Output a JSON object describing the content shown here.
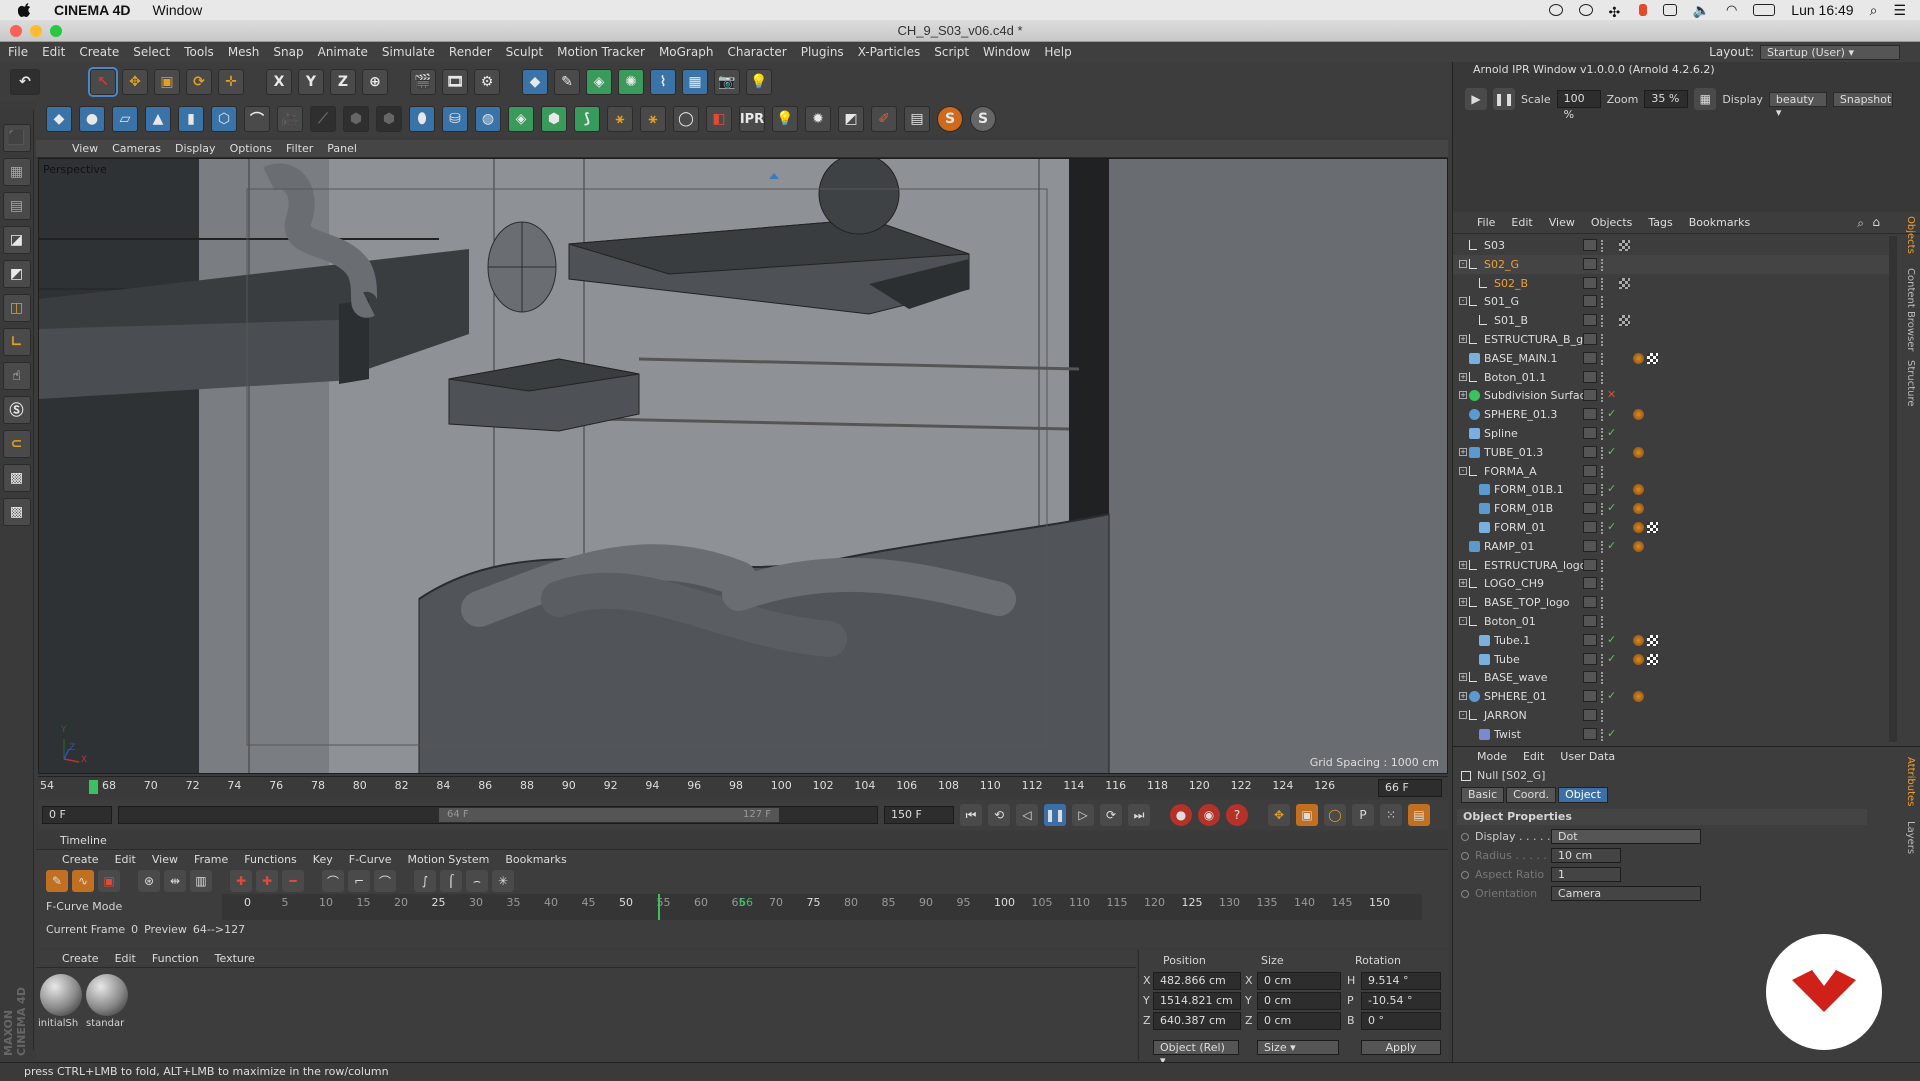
{
  "mac": {
    "app": "CINEMA 4D",
    "window_menu": "Window",
    "clock": "Lun 16:49"
  },
  "window_title": "CH_9_S03_v06.c4d *",
  "main_menu": [
    "File",
    "Edit",
    "Create",
    "Select",
    "Tools",
    "Mesh",
    "Snap",
    "Animate",
    "Simulate",
    "Render",
    "Sculpt",
    "Motion Tracker",
    "MoGraph",
    "Character",
    "Plugins",
    "X-Particles",
    "Script",
    "Window",
    "Help"
  ],
  "layout": {
    "label": "Layout:",
    "value": "Startup (User)"
  },
  "toolbar_row1": [
    "undo",
    "live-select",
    "move",
    "scale",
    "rotate",
    "move-plus",
    "x-axis",
    "y-axis",
    "z-axis",
    "world",
    "render-view",
    "render",
    "render-settings",
    "cube",
    "pen",
    "subdivision",
    "array",
    "deformer",
    "floor",
    "camera",
    "light"
  ],
  "toolbar_row1_labels": {
    "x": "X",
    "y": "Y",
    "z": "Z"
  },
  "toolbar_row2_ipr": "IPR",
  "toolbar_row2_s": "S",
  "viewport_menu": [
    "View",
    "Cameras",
    "Display",
    "Options",
    "Filter",
    "Panel"
  ],
  "viewport": {
    "camera_label": "Perspective",
    "grid_spacing": "Grid Spacing : 1000 cm",
    "axis_y": "Y",
    "axis_z": "Z",
    "axis_x": "X"
  },
  "ruler_ticks": [
    "54",
    "68",
    "70",
    "72",
    "74",
    "76",
    "78",
    "80",
    "82",
    "84",
    "86",
    "88",
    "90",
    "92",
    "94",
    "96",
    "98",
    "100",
    "102",
    "104",
    "106",
    "108",
    "110",
    "112",
    "114",
    "116",
    "118",
    "120",
    "122",
    "124",
    "126"
  ],
  "ruler_current": "66 F",
  "transport": {
    "start_field": "0 F",
    "preview_start": "64 F",
    "preview_end": "127 F",
    "end_field": "150 F"
  },
  "timeline": {
    "title": "Timeline",
    "menu": [
      "Create",
      "Edit",
      "View",
      "Frame",
      "Functions",
      "Key",
      "F-Curve",
      "Motion System",
      "Bookmarks"
    ],
    "mode_label": "F-Curve Mode",
    "ticks": [
      "0",
      "5",
      "10",
      "15",
      "20",
      "25",
      "30",
      "35",
      "40",
      "45",
      "50",
      "55",
      "60",
      "65",
      "66",
      "70",
      "75",
      "80",
      "85",
      "90",
      "95",
      "100",
      "105",
      "110",
      "115",
      "120",
      "125",
      "130",
      "135",
      "140",
      "145",
      "150"
    ],
    "current_frame_label": "Current Frame",
    "current_frame_value": "0",
    "preview_label": "Preview",
    "preview_value": "64-->127"
  },
  "material_manager": {
    "menu": [
      "Create",
      "Edit",
      "Function",
      "Texture"
    ],
    "materials": [
      "initialSh",
      "standar"
    ]
  },
  "coordinates": {
    "headers": [
      "Position",
      "Size",
      "Rotation"
    ],
    "rows": [
      {
        "axis": "X",
        "pos": "482.866 cm",
        "size_axis": "X",
        "size": "0 cm",
        "rot_axis": "H",
        "rot": "9.514 °"
      },
      {
        "axis": "Y",
        "pos": "1514.821 cm",
        "size_axis": "Y",
        "size": "0 cm",
        "rot_axis": "P",
        "rot": "-10.54 °"
      },
      {
        "axis": "Z",
        "pos": "640.387 cm",
        "size_axis": "Z",
        "size": "0 cm",
        "rot_axis": "B",
        "rot": "0 °"
      }
    ],
    "mode_dropdown": "Object (Rel)",
    "size_dropdown": "Size",
    "apply": "Apply"
  },
  "ipr": {
    "title": "Arnold IPR Window v1.0.0.0 (Arnold 4.2.6.2)",
    "scale_label": "Scale",
    "scale_value": "100 %",
    "zoom_label": "Zoom",
    "zoom_value": "35 %",
    "display_label": "Display",
    "display_value": "beauty",
    "snapshot": "Snapshot"
  },
  "object_manager": {
    "menu": [
      "File",
      "Edit",
      "View",
      "Objects",
      "Tags",
      "Bookmarks"
    ],
    "objects": [
      {
        "name": "S03",
        "indent": 0,
        "exp": "",
        "type": "null",
        "color": "#ddd"
      },
      {
        "name": "S02_G",
        "indent": 0,
        "exp": "-",
        "type": "null",
        "color": "#f0a030"
      },
      {
        "name": "S02_B",
        "indent": 1,
        "exp": "",
        "type": "null",
        "color": "#f0a030"
      },
      {
        "name": "S01_G",
        "indent": 0,
        "exp": "-",
        "type": "null",
        "color": "#ddd"
      },
      {
        "name": "S01_B",
        "indent": 1,
        "exp": "",
        "type": "null",
        "color": "#ddd"
      },
      {
        "name": "ESTRUCTURA_B_g",
        "indent": 0,
        "exp": "+",
        "type": "null",
        "color": "#ddd"
      },
      {
        "name": "BASE_MAIN.1",
        "indent": 0,
        "exp": "",
        "type": "spline",
        "color": "#ddd"
      },
      {
        "name": "Boton_01.1",
        "indent": 0,
        "exp": "+",
        "type": "null",
        "color": "#ddd"
      },
      {
        "name": "Subdivision Surface",
        "indent": 0,
        "exp": "+",
        "type": "green",
        "color": "#ddd"
      },
      {
        "name": "SPHERE_01.3",
        "indent": 0,
        "exp": "",
        "type": "sphere",
        "color": "#ddd"
      },
      {
        "name": "Spline",
        "indent": 0,
        "exp": "",
        "type": "spline",
        "color": "#ddd"
      },
      {
        "name": "TUBE_01.3",
        "indent": 0,
        "exp": "+",
        "type": "cube",
        "color": "#ddd"
      },
      {
        "name": "FORMA_A",
        "indent": 0,
        "exp": "-",
        "type": "null",
        "color": "#ddd"
      },
      {
        "name": "FORM_01B.1",
        "indent": 1,
        "exp": "",
        "type": "cube",
        "color": "#ddd"
      },
      {
        "name": "FORM_01B",
        "indent": 1,
        "exp": "",
        "type": "cube",
        "color": "#ddd"
      },
      {
        "name": "FORM_01",
        "indent": 1,
        "exp": "",
        "type": "spline",
        "color": "#ddd"
      },
      {
        "name": "RAMP_01",
        "indent": 0,
        "exp": "",
        "type": "cube",
        "color": "#ddd"
      },
      {
        "name": "ESTRUCTURA_logoG",
        "indent": 0,
        "exp": "+",
        "type": "null",
        "color": "#ddd"
      },
      {
        "name": "LOGO_CH9",
        "indent": 0,
        "exp": "+",
        "type": "null",
        "color": "#ddd"
      },
      {
        "name": "BASE_TOP_logo",
        "indent": 0,
        "exp": "+",
        "type": "null",
        "color": "#ddd"
      },
      {
        "name": "Boton_01",
        "indent": 0,
        "exp": "-",
        "type": "null",
        "color": "#ddd"
      },
      {
        "name": "Tube.1",
        "indent": 1,
        "exp": "",
        "type": "spline",
        "color": "#ddd"
      },
      {
        "name": "Tube",
        "indent": 1,
        "exp": "",
        "type": "spline",
        "color": "#ddd"
      },
      {
        "name": "BASE_wave",
        "indent": 0,
        "exp": "+",
        "type": "null",
        "color": "#ddd"
      },
      {
        "name": "SPHERE_01",
        "indent": 0,
        "exp": "+",
        "type": "sphere",
        "color": "#ddd"
      },
      {
        "name": "JARRON",
        "indent": 0,
        "exp": "-",
        "type": "null",
        "color": "#ddd"
      },
      {
        "name": "Twist",
        "indent": 1,
        "exp": "",
        "type": "twist",
        "color": "#ddd"
      }
    ]
  },
  "side_tabs": [
    "Objects",
    "Content Browser",
    "Structure"
  ],
  "attr_side_tabs": [
    "Attributes",
    "Layers"
  ],
  "attributes": {
    "menu": [
      "Mode",
      "Edit",
      "User Data"
    ],
    "object_title": "Null [S02_G]",
    "tabs": [
      "Basic",
      "Coord.",
      "Object"
    ],
    "section": "Object Properties",
    "props": [
      {
        "label": "Display . . . . .",
        "value": "Dot",
        "enabled": true
      },
      {
        "label": "Radius . . . . .",
        "value": "10 cm",
        "enabled": false
      },
      {
        "label": "Aspect Ratio",
        "value": "1",
        "enabled": false
      },
      {
        "label": "Orientation",
        "value": "Camera",
        "enabled": false
      }
    ]
  },
  "left_brand": "MAXON CINEMA 4D",
  "status": "press CTRL+LMB to fold, ALT+LMB to maximize in the row/column"
}
